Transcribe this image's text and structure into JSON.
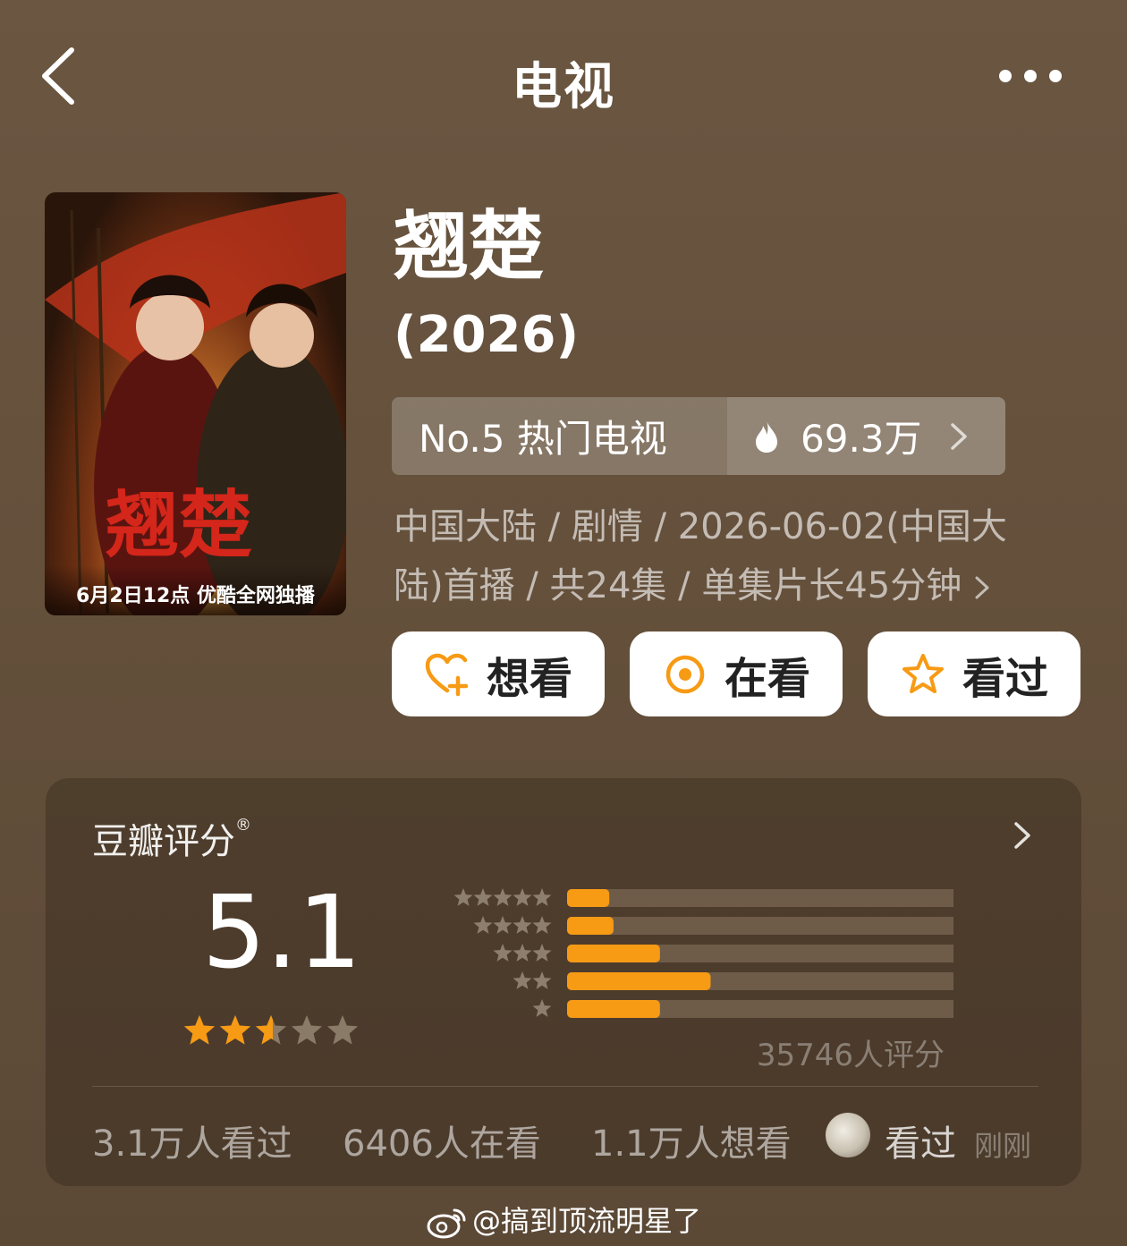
{
  "header": {
    "title": "电视",
    "back_icon": "chevron-left-icon",
    "more_icon": "more-dots-icon"
  },
  "poster": {
    "caption": "6月2日12点 优酷全网独播",
    "art_title": "翘楚"
  },
  "show": {
    "title": "翘楚",
    "year": "(2026)",
    "rank_label": "No.5 热门电视",
    "heat_value": "69.3万",
    "info_line1": "中国大陆 / 剧情 / 2026-06-02(中国大",
    "info_line2": "陆)首播 / 共24集 / 单集片长45分钟"
  },
  "actions": {
    "want": "想看",
    "watching": "在看",
    "watched": "看过"
  },
  "rating": {
    "title": "豆瓣评分",
    "registered_mark": "®",
    "score": "5.1",
    "score_stars": 2.5,
    "rating_count": "35746人评分",
    "distribution_fraction": [
      {
        "stars": 5,
        "fraction": 0.1
      },
      {
        "stars": 4,
        "fraction": 0.11
      },
      {
        "stars": 3,
        "fraction": 0.22
      },
      {
        "stars": 2,
        "fraction": 0.34
      },
      {
        "stars": 1,
        "fraction": 0.22
      }
    ]
  },
  "stats": {
    "watched_count": "3.1万人看过",
    "watching_count": "6406人在看",
    "want_count": "1.1万人想看",
    "my_status": "看过",
    "my_time": "刚刚"
  },
  "watermark": "@搞到顶流明星了",
  "colors": {
    "accent": "#f79a14",
    "bar_track": "#6e5c49",
    "background": "#64503b"
  }
}
